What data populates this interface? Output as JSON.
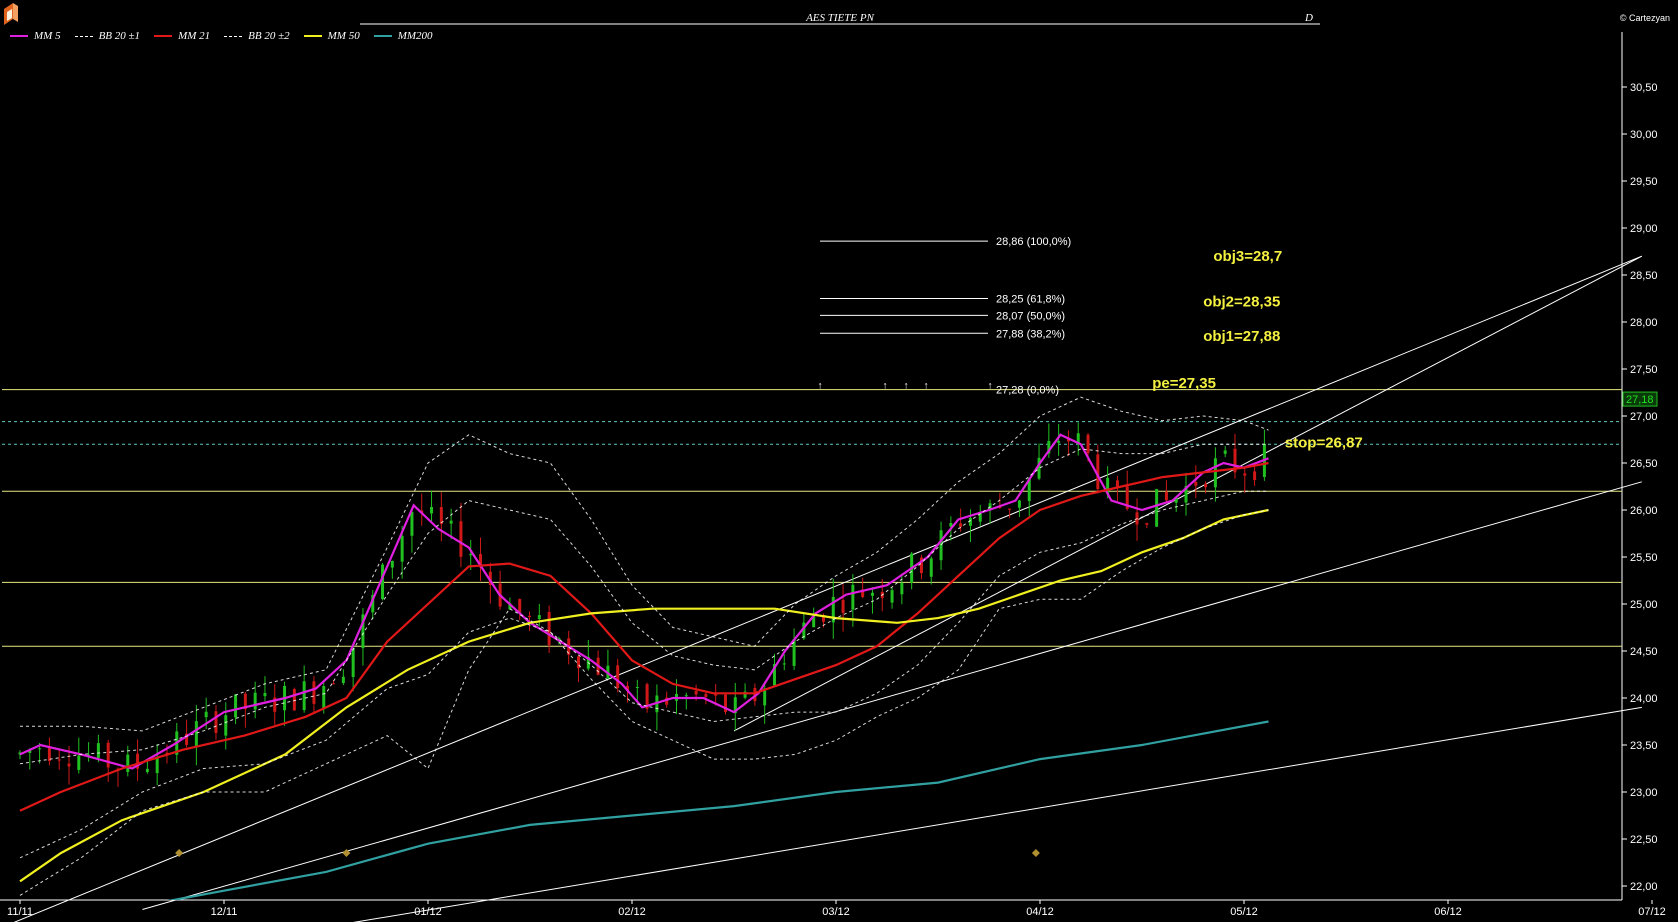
{
  "header": {
    "title": "AES TIETE PN",
    "period": "D",
    "copyright": "© Cartezyan"
  },
  "legend": [
    {
      "label": "MM  5",
      "color": "#e020e0",
      "style": "solid"
    },
    {
      "label": "BB 20 ±1",
      "color": "#ffffff",
      "style": "dashed"
    },
    {
      "label": "MM 21",
      "color": "#e01818",
      "style": "solid"
    },
    {
      "label": "BB 20 ±2",
      "color": "#ffffff",
      "style": "dashed"
    },
    {
      "label": "MM 50",
      "color": "#f0f020",
      "style": "solid"
    },
    {
      "label": "MM200",
      "color": "#30a0a0",
      "style": "solid"
    }
  ],
  "chart_data": {
    "type": "candlestick",
    "title": "AES TIETE PN",
    "x_tick_labels": [
      "11/11",
      "12/11",
      "01/12",
      "02/12",
      "03/12",
      "04/12",
      "05/12",
      "06/12",
      "07/12"
    ],
    "y_tick_labels": [
      "22,00",
      "22,50",
      "23,00",
      "23,50",
      "24,00",
      "24,50",
      "25,00",
      "25,50",
      "26,00",
      "26,50",
      "27,00",
      "27,50",
      "28,00",
      "28,50",
      "29,00",
      "29,50",
      "30,00",
      "30,50"
    ],
    "y_ticks": [
      22.0,
      22.5,
      23.0,
      23.5,
      24.0,
      24.5,
      25.0,
      25.5,
      26.0,
      26.5,
      27.0,
      27.5,
      28.0,
      28.5,
      29.0,
      29.5,
      30.0,
      30.5
    ],
    "ylim": [
      21.6,
      31.0
    ],
    "last_price": "27,18",
    "last_price_value": 27.18,
    "months": [
      {
        "label": "11/11",
        "close": 23.4
      },
      {
        "label": "12/11",
        "close": 23.9
      },
      {
        "label": "01/12",
        "close": 26.0
      },
      {
        "label": "02/12",
        "close": 24.0
      },
      {
        "label": "03/12",
        "close": 24.9
      },
      {
        "label": "04/12",
        "close": 26.8
      },
      {
        "label": "05/12",
        "close": 27.18
      }
    ],
    "series": [
      {
        "name": "MM  5",
        "key": "mm5",
        "color": "#e020e0",
        "points": [
          [
            0,
            23.4
          ],
          [
            0.1,
            23.5
          ],
          [
            0.3,
            23.4
          ],
          [
            0.55,
            23.25
          ],
          [
            0.75,
            23.5
          ],
          [
            1.0,
            23.85
          ],
          [
            1.3,
            24.0
          ],
          [
            1.45,
            24.1
          ],
          [
            1.6,
            24.4
          ],
          [
            1.8,
            25.4
          ],
          [
            1.93,
            26.05
          ],
          [
            2.05,
            25.8
          ],
          [
            2.2,
            25.6
          ],
          [
            2.35,
            25.1
          ],
          [
            2.5,
            24.8
          ],
          [
            2.65,
            24.6
          ],
          [
            2.8,
            24.4
          ],
          [
            2.95,
            24.15
          ],
          [
            3.05,
            23.9
          ],
          [
            3.2,
            24.0
          ],
          [
            3.35,
            24.0
          ],
          [
            3.5,
            23.85
          ],
          [
            3.62,
            24.05
          ],
          [
            3.75,
            24.5
          ],
          [
            3.9,
            24.9
          ],
          [
            4.05,
            25.1
          ],
          [
            4.25,
            25.2
          ],
          [
            4.45,
            25.5
          ],
          [
            4.6,
            25.9
          ],
          [
            4.75,
            26.0
          ],
          [
            4.88,
            26.1
          ],
          [
            5.0,
            26.5
          ],
          [
            5.1,
            26.8
          ],
          [
            5.2,
            26.7
          ],
          [
            5.35,
            26.1
          ],
          [
            5.5,
            26.0
          ],
          [
            5.65,
            26.1
          ],
          [
            5.8,
            26.4
          ],
          [
            5.9,
            26.5
          ],
          [
            6.0,
            26.45
          ],
          [
            6.12,
            26.55
          ]
        ]
      },
      {
        "name": "MM 21",
        "key": "mm21",
        "color": "#e01818",
        "points": [
          [
            0,
            22.8
          ],
          [
            0.2,
            23.0
          ],
          [
            0.5,
            23.25
          ],
          [
            0.8,
            23.45
          ],
          [
            1.1,
            23.6
          ],
          [
            1.4,
            23.8
          ],
          [
            1.6,
            24.0
          ],
          [
            1.8,
            24.6
          ],
          [
            2.0,
            25.0
          ],
          [
            2.2,
            25.4
          ],
          [
            2.4,
            25.43
          ],
          [
            2.6,
            25.3
          ],
          [
            2.8,
            24.9
          ],
          [
            3.0,
            24.4
          ],
          [
            3.2,
            24.15
          ],
          [
            3.4,
            24.05
          ],
          [
            3.6,
            24.05
          ],
          [
            3.8,
            24.2
          ],
          [
            4.0,
            24.35
          ],
          [
            4.2,
            24.55
          ],
          [
            4.4,
            24.9
          ],
          [
            4.6,
            25.3
          ],
          [
            4.8,
            25.7
          ],
          [
            5.0,
            26.0
          ],
          [
            5.2,
            26.15
          ],
          [
            5.4,
            26.25
          ],
          [
            5.6,
            26.35
          ],
          [
            5.8,
            26.4
          ],
          [
            6.0,
            26.45
          ],
          [
            6.12,
            26.5
          ]
        ]
      },
      {
        "name": "MM 50",
        "key": "mm50",
        "color": "#f0f020",
        "points": [
          [
            0,
            22.05
          ],
          [
            0.2,
            22.35
          ],
          [
            0.5,
            22.7
          ],
          [
            0.9,
            23.0
          ],
          [
            1.3,
            23.4
          ],
          [
            1.6,
            23.9
          ],
          [
            1.9,
            24.3
          ],
          [
            2.2,
            24.6
          ],
          [
            2.5,
            24.8
          ],
          [
            2.8,
            24.9
          ],
          [
            3.1,
            24.95
          ],
          [
            3.4,
            24.95
          ],
          [
            3.7,
            24.95
          ],
          [
            4.0,
            24.85
          ],
          [
            4.3,
            24.8
          ],
          [
            4.5,
            24.85
          ],
          [
            4.7,
            24.95
          ],
          [
            4.9,
            25.1
          ],
          [
            5.1,
            25.25
          ],
          [
            5.3,
            25.35
          ],
          [
            5.5,
            25.55
          ],
          [
            5.7,
            25.7
          ],
          [
            5.9,
            25.9
          ],
          [
            6.12,
            26.0
          ]
        ]
      },
      {
        "name": "MM200",
        "key": "mm200",
        "color": "#30a0a0",
        "points": [
          [
            0,
            21.55
          ],
          [
            0.5,
            21.75
          ],
          [
            1.0,
            21.95
          ],
          [
            1.5,
            22.15
          ],
          [
            2.0,
            22.45
          ],
          [
            2.5,
            22.65
          ],
          [
            3.0,
            22.75
          ],
          [
            3.5,
            22.85
          ],
          [
            4.0,
            23.0
          ],
          [
            4.5,
            23.1
          ],
          [
            5.0,
            23.35
          ],
          [
            5.5,
            23.5
          ],
          [
            6.12,
            23.75
          ]
        ]
      },
      {
        "name": "BB 20 +2",
        "key": "bbu2",
        "color": "#ffffff",
        "dashed": true,
        "points": [
          [
            0,
            23.7
          ],
          [
            0.3,
            23.7
          ],
          [
            0.6,
            23.65
          ],
          [
            0.9,
            23.9
          ],
          [
            1.2,
            24.15
          ],
          [
            1.5,
            24.3
          ],
          [
            1.8,
            25.6
          ],
          [
            2.0,
            26.5
          ],
          [
            2.2,
            26.8
          ],
          [
            2.4,
            26.6
          ],
          [
            2.6,
            26.5
          ],
          [
            2.8,
            25.9
          ],
          [
            3.0,
            25.2
          ],
          [
            3.2,
            24.75
          ],
          [
            3.4,
            24.65
          ],
          [
            3.6,
            24.55
          ],
          [
            3.8,
            25.0
          ],
          [
            4.0,
            25.3
          ],
          [
            4.2,
            25.55
          ],
          [
            4.4,
            25.9
          ],
          [
            4.6,
            26.3
          ],
          [
            4.8,
            26.6
          ],
          [
            5.0,
            27.0
          ],
          [
            5.2,
            27.2
          ],
          [
            5.4,
            27.05
          ],
          [
            5.6,
            26.95
          ],
          [
            5.8,
            27.0
          ],
          [
            6.0,
            26.95
          ],
          [
            6.12,
            26.85
          ]
        ]
      },
      {
        "name": "BB 20 +1",
        "key": "bbu1",
        "color": "#ffffff",
        "dashed": true,
        "points": [
          [
            0,
            23.3
          ],
          [
            0.3,
            23.4
          ],
          [
            0.6,
            23.45
          ],
          [
            0.9,
            23.65
          ],
          [
            1.2,
            23.9
          ],
          [
            1.5,
            24.05
          ],
          [
            1.8,
            25.1
          ],
          [
            2.0,
            25.75
          ],
          [
            2.2,
            26.1
          ],
          [
            2.4,
            26.0
          ],
          [
            2.6,
            25.9
          ],
          [
            2.8,
            25.4
          ],
          [
            3.0,
            24.8
          ],
          [
            3.2,
            24.45
          ],
          [
            3.4,
            24.35
          ],
          [
            3.6,
            24.3
          ],
          [
            3.8,
            24.6
          ],
          [
            4.0,
            24.85
          ],
          [
            4.2,
            25.05
          ],
          [
            4.4,
            25.4
          ],
          [
            4.6,
            25.8
          ],
          [
            4.8,
            26.1
          ],
          [
            5.0,
            26.45
          ],
          [
            5.2,
            26.65
          ],
          [
            5.4,
            26.6
          ],
          [
            5.6,
            26.6
          ],
          [
            5.8,
            26.7
          ],
          [
            6.0,
            26.7
          ],
          [
            6.12,
            26.7
          ]
        ]
      },
      {
        "name": "BB 20 -1",
        "key": "bbl1",
        "color": "#ffffff",
        "dashed": true,
        "points": [
          [
            0,
            22.3
          ],
          [
            0.3,
            22.6
          ],
          [
            0.6,
            23.0
          ],
          [
            0.9,
            23.25
          ],
          [
            1.2,
            23.3
          ],
          [
            1.5,
            23.55
          ],
          [
            1.8,
            24.1
          ],
          [
            2.0,
            24.25
          ],
          [
            2.2,
            24.7
          ],
          [
            2.4,
            24.85
          ],
          [
            2.6,
            24.7
          ],
          [
            2.8,
            24.35
          ],
          [
            3.0,
            23.95
          ],
          [
            3.2,
            23.85
          ],
          [
            3.4,
            23.75
          ],
          [
            3.6,
            23.8
          ],
          [
            3.8,
            23.85
          ],
          [
            4.0,
            23.85
          ],
          [
            4.2,
            24.05
          ],
          [
            4.4,
            24.35
          ],
          [
            4.6,
            24.8
          ],
          [
            4.8,
            25.3
          ],
          [
            5.0,
            25.55
          ],
          [
            5.2,
            25.65
          ],
          [
            5.4,
            25.85
          ],
          [
            5.6,
            26.0
          ],
          [
            5.8,
            26.1
          ],
          [
            6.0,
            26.2
          ],
          [
            6.12,
            26.2
          ]
        ]
      },
      {
        "name": "BB 20 -2",
        "key": "bbl2",
        "color": "#ffffff",
        "dashed": true,
        "points": [
          [
            0,
            21.9
          ],
          [
            0.3,
            22.3
          ],
          [
            0.6,
            22.8
          ],
          [
            0.9,
            23.0
          ],
          [
            1.2,
            23.0
          ],
          [
            1.5,
            23.3
          ],
          [
            1.8,
            23.6
          ],
          [
            2.0,
            23.25
          ],
          [
            2.2,
            24.3
          ],
          [
            2.4,
            24.95
          ],
          [
            2.6,
            24.7
          ],
          [
            2.8,
            24.2
          ],
          [
            3.0,
            23.75
          ],
          [
            3.2,
            23.55
          ],
          [
            3.4,
            23.35
          ],
          [
            3.6,
            23.35
          ],
          [
            3.8,
            23.4
          ],
          [
            4.0,
            23.55
          ],
          [
            4.2,
            23.8
          ],
          [
            4.4,
            24.0
          ],
          [
            4.6,
            24.3
          ],
          [
            4.8,
            24.95
          ],
          [
            5.0,
            25.05
          ],
          [
            5.2,
            25.05
          ],
          [
            5.4,
            25.35
          ],
          [
            5.6,
            25.6
          ],
          [
            5.8,
            25.8
          ],
          [
            6.0,
            25.95
          ],
          [
            6.12,
            26.0
          ]
        ]
      }
    ],
    "trendlines": [
      {
        "from": [
          -0.1,
          21.55
        ],
        "to": [
          7.95,
          28.7
        ]
      },
      {
        "from": [
          0.6,
          21.75
        ],
        "to": [
          7.95,
          26.3
        ]
      },
      {
        "from": [
          1.6,
          21.6
        ],
        "to": [
          7.95,
          23.9
        ]
      },
      {
        "from": [
          3.5,
          23.65
        ],
        "to": [
          7.95,
          28.7
        ]
      }
    ],
    "horizontal_lines": [
      {
        "value": 27.28,
        "color": "#e8e880",
        "dashed": false
      },
      {
        "value": 26.94,
        "color": "#60c8c0",
        "dashed": true
      },
      {
        "value": 26.7,
        "color": "#60c8c0",
        "dashed": true
      },
      {
        "value": 26.2,
        "color": "#e8e880",
        "dashed": false
      },
      {
        "value": 25.23,
        "color": "#e8e880",
        "dashed": false
      },
      {
        "value": 24.55,
        "color": "#e8e880",
        "dashed": false
      }
    ],
    "fibonacci": [
      {
        "value": 28.86,
        "label": "28,86 (100,0%)"
      },
      {
        "value": 28.25,
        "label": "28,25 (61,8%)"
      },
      {
        "value": 28.07,
        "label": "28,07 (50,0%)"
      },
      {
        "value": 27.88,
        "label": "27,88 (38,2%)"
      },
      {
        "value": 27.28,
        "label": "27,28 (0,0%)"
      }
    ],
    "annotations": [
      {
        "text": "obj3=28,7",
        "x": 5.85,
        "y": 28.7
      },
      {
        "text": "obj2=28,35",
        "x": 5.8,
        "y": 28.22
      },
      {
        "text": "obj1=27,88",
        "x": 5.8,
        "y": 27.85
      },
      {
        "text": "pe=27,35",
        "x": 5.55,
        "y": 27.35
      },
      {
        "text": "stop=26,87",
        "x": 6.2,
        "y": 26.72
      }
    ],
    "grid": false,
    "legend_position": "top-left"
  }
}
